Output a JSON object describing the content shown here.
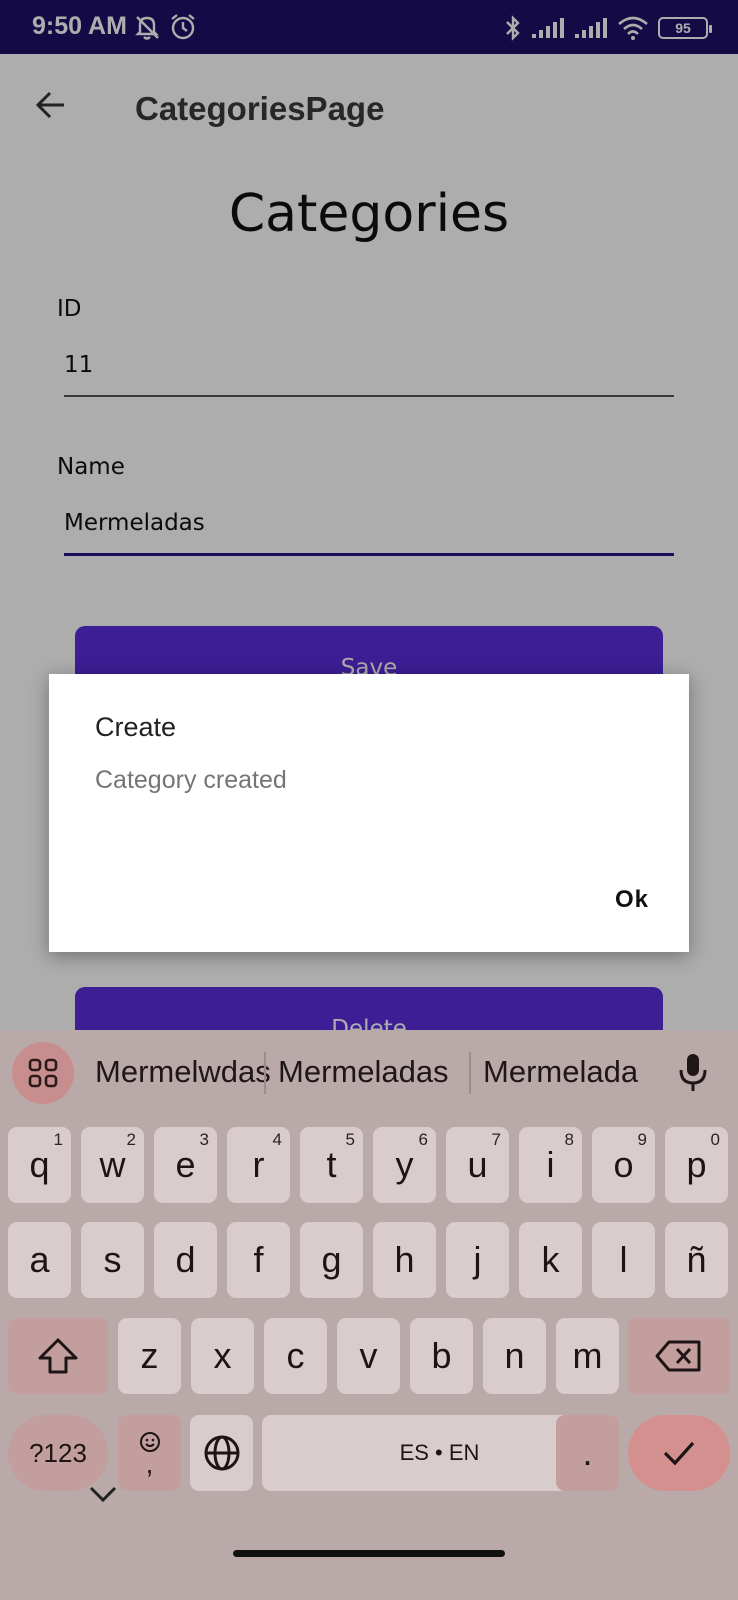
{
  "status_bar": {
    "time": "9:50 AM",
    "battery": "95",
    "icons": [
      "muted-bell-icon",
      "alarm-icon",
      "bluetooth-icon",
      "signal-icon",
      "signal-icon",
      "wifi-icon",
      "battery-icon"
    ]
  },
  "app_bar": {
    "title": "CategoriesPage"
  },
  "page": {
    "heading": "Categories",
    "fields": {
      "id_label": "ID",
      "id_value": "11",
      "name_label": "Name",
      "name_value": "Mermeladas"
    },
    "save_label": "Save",
    "delete_label": "Delete"
  },
  "dialog": {
    "title": "Create",
    "message": "Category created",
    "ok_label": "Ok"
  },
  "keyboard": {
    "suggestions": [
      "Mermelwdas",
      "Mermeladas",
      "Mermelada"
    ],
    "row1": [
      {
        "k": "q",
        "h": "1"
      },
      {
        "k": "w",
        "h": "2"
      },
      {
        "k": "e",
        "h": "3"
      },
      {
        "k": "r",
        "h": "4"
      },
      {
        "k": "t",
        "h": "5"
      },
      {
        "k": "y",
        "h": "6"
      },
      {
        "k": "u",
        "h": "7"
      },
      {
        "k": "i",
        "h": "8"
      },
      {
        "k": "o",
        "h": "9"
      },
      {
        "k": "p",
        "h": "0"
      }
    ],
    "row2": [
      "a",
      "s",
      "d",
      "f",
      "g",
      "h",
      "j",
      "k",
      "l",
      "ñ"
    ],
    "row3": [
      "z",
      "x",
      "c",
      "v",
      "b",
      "n",
      "m"
    ],
    "symbols_label": "?123",
    "comma_label": ",",
    "space_label": "ES • EN",
    "period_label": ".",
    "colors": {
      "keyboard_bg": "#baa9a9",
      "key": "#d9cccc",
      "function_key": "#c39e9e",
      "enter": "#d48f8f"
    }
  },
  "colors": {
    "status_bar": "#1e1066",
    "accent": "#5b2ddc",
    "focused_underline": "#2b148f"
  }
}
